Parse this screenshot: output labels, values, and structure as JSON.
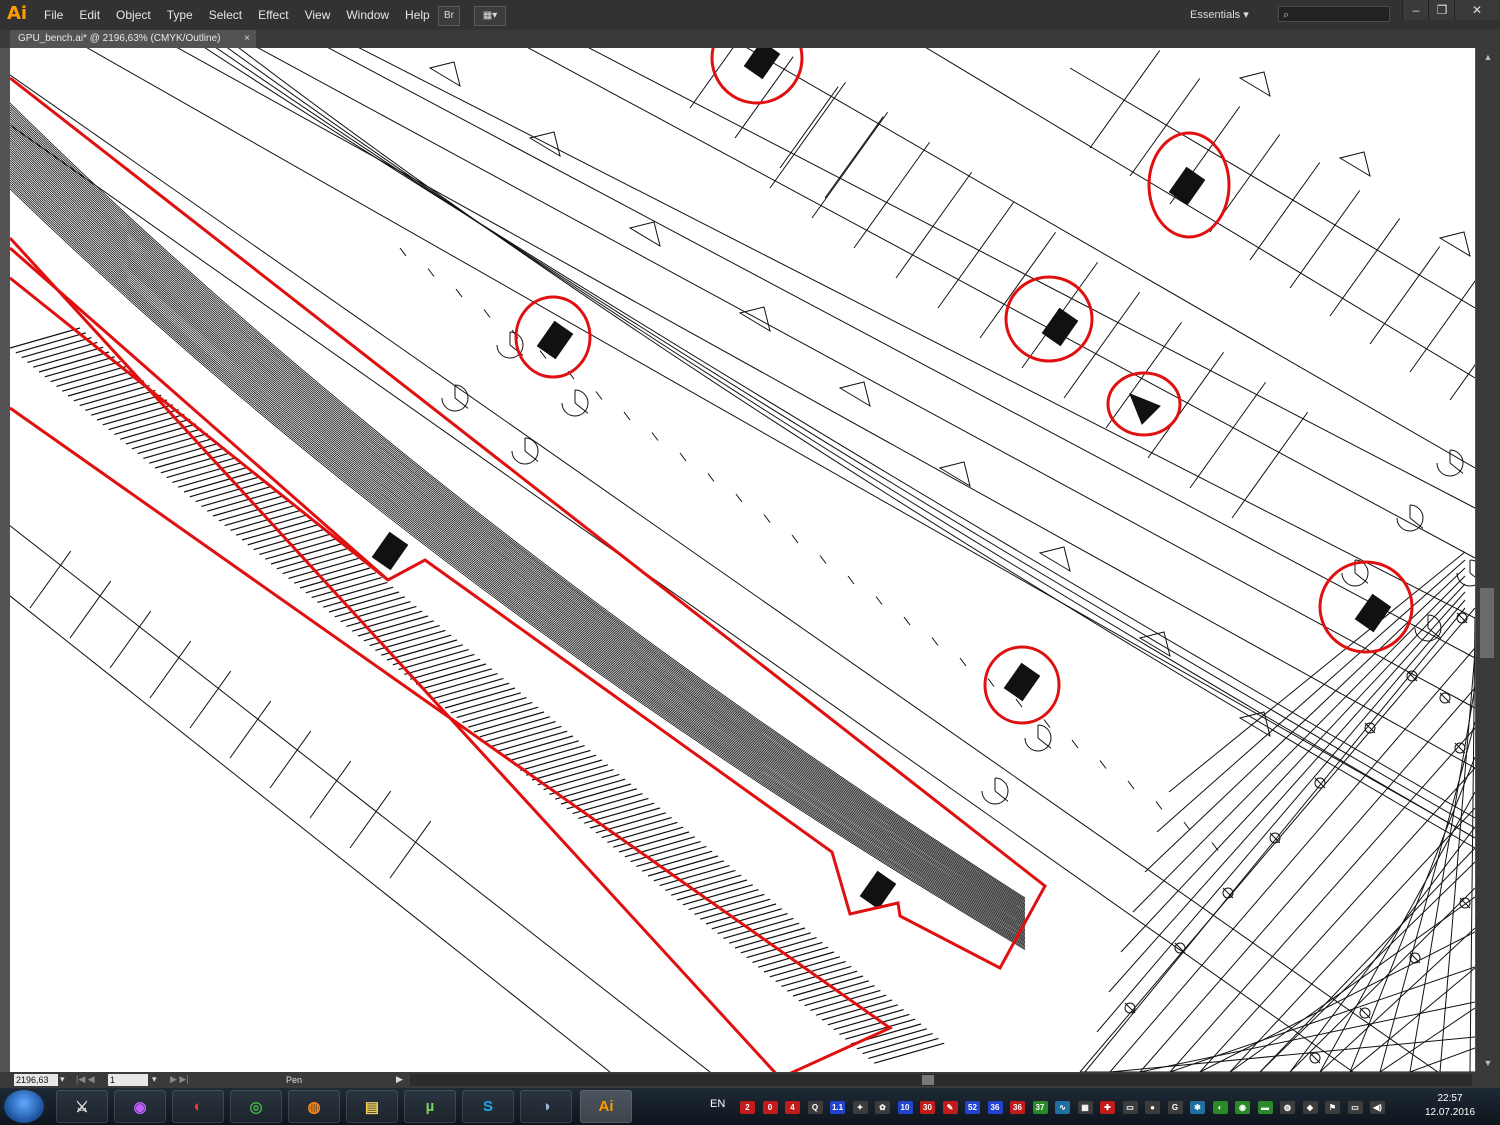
{
  "app": {
    "logo": "Ai",
    "menus": [
      "File",
      "Edit",
      "Object",
      "Type",
      "Select",
      "Effect",
      "View",
      "Window",
      "Help"
    ]
  },
  "toolbar": {
    "bridge_label": "Br",
    "arrange_label": "▦▾"
  },
  "workspace": {
    "label": "Essentials ▾",
    "search_placeholder": "⌕"
  },
  "window_controls": {
    "minimize": "–",
    "restore": "❐",
    "close": "✕"
  },
  "document_tab": {
    "title": "GPU_bench.ai* @ 2196,63% (CMYK/Outline)",
    "close": "×"
  },
  "status": {
    "zoom": "2196,63",
    "page": "1",
    "tool": "Pen"
  },
  "taskbar": {
    "language": "EN",
    "apps": [
      {
        "name": "skyrim-icon",
        "glyph": "⚔",
        "color": "#dddddd"
      },
      {
        "name": "swirl-icon",
        "glyph": "◉",
        "color": "#c061ff"
      },
      {
        "name": "browser-red-icon",
        "glyph": "◐",
        "color": "#e83a3a"
      },
      {
        "name": "chrome-icon",
        "glyph": "◎",
        "color": "#46b04a"
      },
      {
        "name": "firefox-icon",
        "glyph": "◍",
        "color": "#ff8a1a"
      },
      {
        "name": "explorer-icon",
        "glyph": "▤",
        "color": "#f3cf59"
      },
      {
        "name": "utorrent-icon",
        "glyph": "µ",
        "color": "#7bd35a"
      },
      {
        "name": "skype-icon",
        "glyph": "S",
        "color": "#20a6ea"
      },
      {
        "name": "media-icon",
        "glyph": "◑",
        "color": "#9fb6d8"
      },
      {
        "name": "illustrator-icon",
        "glyph": "Ai",
        "color": "#ff9a00"
      }
    ],
    "tray": [
      {
        "t": "2",
        "c": "#c21b1b"
      },
      {
        "t": "0",
        "c": "#c21b1b"
      },
      {
        "t": "4",
        "c": "#c21b1b"
      },
      {
        "t": "Q",
        "c": "#3c3c3c"
      },
      {
        "t": "1.1",
        "c": "#2244cc"
      },
      {
        "t": "✦",
        "c": "#3c3c3c"
      },
      {
        "t": "✿",
        "c": "#3c3c3c"
      },
      {
        "t": "10",
        "c": "#2244cc"
      },
      {
        "t": "30",
        "c": "#c21b1b"
      },
      {
        "t": "✎",
        "c": "#c21b1b"
      },
      {
        "t": "52",
        "c": "#2244cc"
      },
      {
        "t": "36",
        "c": "#2244cc"
      },
      {
        "t": "36",
        "c": "#c21b1b"
      },
      {
        "t": "37",
        "c": "#2a8a2a"
      },
      {
        "t": "∿",
        "c": "#1f6fa0"
      },
      {
        "t": "▦",
        "c": "#3c3c3c"
      },
      {
        "t": "✚",
        "c": "#c21b1b"
      },
      {
        "t": "▭",
        "c": "#3c3c3c"
      },
      {
        "t": "●",
        "c": "#3c3c3c"
      },
      {
        "t": "G",
        "c": "#3c3c3c"
      },
      {
        "t": "✱",
        "c": "#1f6fa0"
      },
      {
        "t": "◐",
        "c": "#2a8a2a"
      },
      {
        "t": "◉",
        "c": "#2a8a2a"
      },
      {
        "t": "▬",
        "c": "#2a8a2a"
      },
      {
        "t": "◍",
        "c": "#3c3c3c"
      },
      {
        "t": "◆",
        "c": "#3c3c3c"
      },
      {
        "t": "⚑",
        "c": "#3c3c3c"
      },
      {
        "t": "▭",
        "c": "#3c3c3c"
      },
      {
        "t": "◀)",
        "c": "#3c3c3c"
      }
    ],
    "time": "22:57",
    "date": "12.07.2016"
  }
}
